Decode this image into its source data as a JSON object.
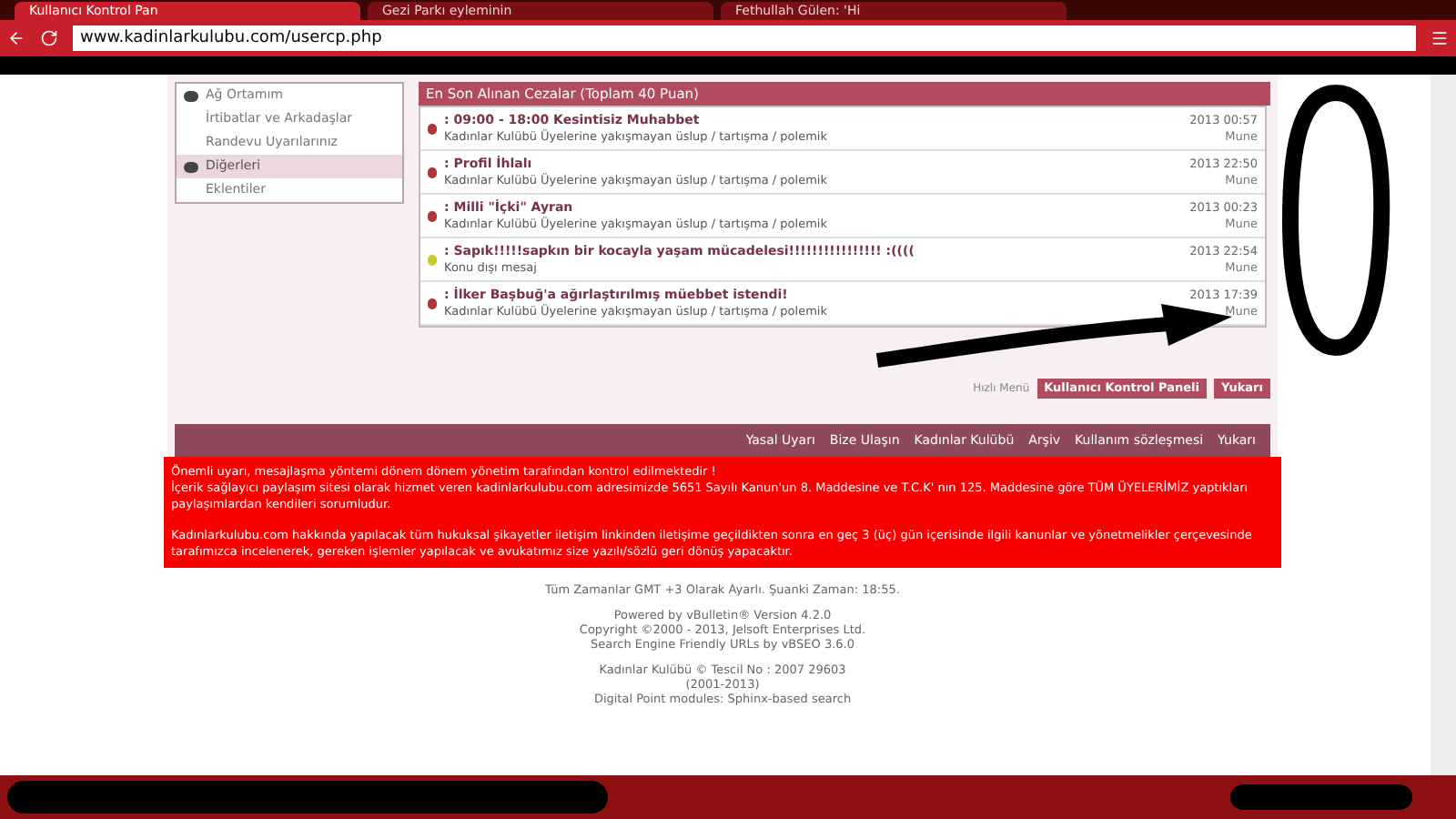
{
  "browser": {
    "tabs": [
      {
        "label": "Kullanıcı Kontrol Pan",
        "selected": true
      },
      {
        "label": "Gezi Parkı eyleminin",
        "selected": false
      },
      {
        "label": "Fethullah Gülen: 'Hi",
        "selected": false
      }
    ],
    "address": "www.kadinlarkulubu.com/usercp.php"
  },
  "sidebar": {
    "items": [
      {
        "label": "Ağ Ortamım",
        "kind": "header",
        "selected": false
      },
      {
        "label": "İrtibatlar ve Arkadaşlar",
        "kind": "link",
        "selected": false
      },
      {
        "label": "Randevu Uyarılarınız",
        "kind": "link",
        "selected": false
      },
      {
        "label": "Diğerleri",
        "kind": "header",
        "selected": true
      },
      {
        "label": "Eklentiler",
        "kind": "link",
        "selected": false
      }
    ]
  },
  "penalties": {
    "title": "En Son Alınan Cezalar (Toplam 40 Puan)",
    "rows": [
      {
        "title": ": 09:00 - 18:00 Kesintisiz Muhabbet",
        "reason": "Kadınlar Kulübü Üyelerine yakışmayan üslup / tartışma / polemik",
        "date": "2013 00:57",
        "user": "Mune",
        "color": "#b0343c"
      },
      {
        "title": ": Profil İhlalı",
        "reason": "Kadınlar Kulübü Üyelerine yakışmayan üslup / tartışma / polemik",
        "date": "2013 22:50",
        "user": "Mune",
        "color": "#b0343c"
      },
      {
        "title": ": Milli \"İçki\" Ayran",
        "reason": "Kadınlar Kulübü Üyelerine yakışmayan üslup / tartışma / polemik",
        "date": "2013 00:23",
        "user": "Mune",
        "color": "#b0343c"
      },
      {
        "title": ": Sapık!!!!!sapkın bir kocayla yaşam mücadelesi!!!!!!!!!!!!!!!! :((((",
        "reason": "Konu dışı mesaj",
        "date": "2013 22:54",
        "user": "Mune",
        "color": "#c8c830"
      },
      {
        "title": ": İlker Başbuğ'a ağırlaştırılmış müebbet istendi!",
        "reason": "Kadınlar Kulübü Üyelerine yakışmayan üslup / tartışma / polemik",
        "date": "2013 17:39",
        "user": "Mune",
        "color": "#b0343c"
      }
    ]
  },
  "quick_menu": {
    "label": "Hızlı Menü",
    "buttons": [
      "Kullanıcı Kontrol Paneli",
      "Yukarı"
    ]
  },
  "footer_links": [
    "Yasal Uyarı",
    "Bize Ulaşın",
    "Kadınlar Kulübü",
    "Arşiv",
    "Kullanım sözleşmesi",
    "Yukarı"
  ],
  "notice": [
    "Önemli uyarı, mesajlaşma yöntemi dönem dönem yönetim tarafından kontrol edilmektedir !",
    "İçerik sağlayıcı paylaşım sitesi olarak hizmet veren kadinlarkulubu.com adresimizde 5651 Sayılı Kanun'un 8. Maddesine ve T.C.K' nın 125. Maddesine göre TÜM ÜYELERİMİZ yaptıkları paylaşımlardan kendileri sorumludur.",
    "Kadınlarkulubu.com hakkında yapılacak tüm hukuksal şikayetler iletişim linkinden iletişime geçildikten sonra en geç 3 (üç) gün içerisinde ilgili kanunlar ve yönetmelikler çerçevesinde tarafımızca incelenerek, gereken işlemler yapılacak ve avukatımız size yazılı/sözlü geri dönüş yapacaktır."
  ],
  "footer_lines": [
    "Tüm Zamanlar GMT +3 Olarak Ayarlı. Şuanki Zaman: 18:55.",
    "Powered by vBulletin® Version 4.2.0",
    "Copyright ©2000 - 2013, Jelsoft Enterprises Ltd.",
    "Search Engine Friendly URLs by vBSEO 3.6.0",
    "Kadınlar Kulübü © Tescil No : 2007 29603",
    "(2001-2013)",
    "Digital Point modules: Sphinx-based search"
  ]
}
